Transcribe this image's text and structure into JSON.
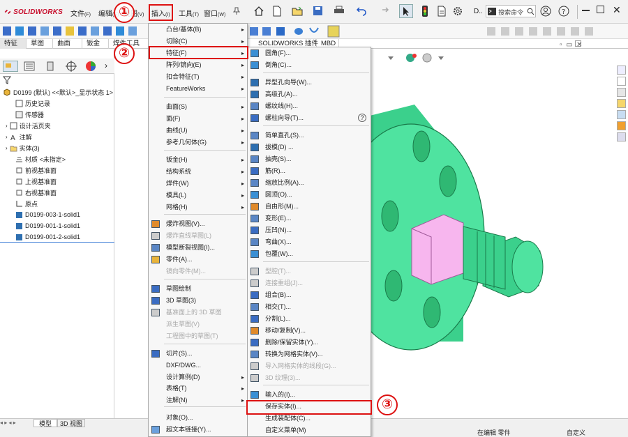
{
  "app": {
    "logo": "SOLIDWORKS"
  },
  "menubar": {
    "file": "文件",
    "file_k": "(F)",
    "edit": "编辑",
    "edit_k": "(E)",
    "view": "视图",
    "view_k": "(V)",
    "insert": "插入",
    "insert_k": "(I)",
    "tools": "工具",
    "tools_k": "(T)",
    "window": "窗口",
    "window_k": "(W)",
    "d_label": "D..",
    "search_placeholder": "搜索命令"
  },
  "tabs": [
    "特征",
    "草图",
    "曲面",
    "钣金",
    "焊件工具",
    "SOLIDWORKS 插件",
    "MBD"
  ],
  "tree": {
    "root": "D0199 (默认) <<默认>_显示状态 1>",
    "items": [
      "历史记录",
      "传感器",
      "设计活页夹",
      "注解",
      "实体(3)",
      "材质 <未指定>",
      "前视基准面",
      "上视基准面",
      "右视基准面",
      "原点",
      "D0199-003-1-solid1",
      "D0199-001-1-solid1",
      "D0199-001-2-solid1"
    ]
  },
  "insert_menu": [
    {
      "label": "凸台/基体(B)",
      "sub": true,
      "disabled": false
    },
    {
      "label": "切除(C)",
      "sub": true,
      "disabled": false
    },
    {
      "label": "特征(F)",
      "sub": true,
      "disabled": false
    },
    {
      "label": "阵列/镜向(E)",
      "sub": true,
      "disabled": false
    },
    {
      "label": "扣合特征(T)",
      "sub": true,
      "disabled": false
    },
    {
      "label": "FeatureWorks",
      "sub": true,
      "disabled": false
    },
    {
      "label": "曲面(S)",
      "sub": true,
      "disabled": false
    },
    {
      "label": "面(F)",
      "sub": true,
      "disabled": false
    },
    {
      "label": "曲线(U)",
      "sub": true,
      "disabled": false
    },
    {
      "label": "参考几何体(G)",
      "sub": true,
      "disabled": false
    },
    {
      "label": "钣金(H)",
      "sub": true,
      "disabled": false
    },
    {
      "label": "结构系统",
      "sub": true,
      "disabled": false
    },
    {
      "label": "焊件(W)",
      "sub": true,
      "disabled": false
    },
    {
      "label": "模具(L)",
      "sub": true,
      "disabled": false
    },
    {
      "label": "网格(H)",
      "sub": true,
      "disabled": false
    },
    {
      "label": "爆炸视图(V)...",
      "sub": false,
      "disabled": false
    },
    {
      "label": "爆炸直线草图(L)",
      "sub": false,
      "disabled": true
    },
    {
      "label": "模型断裂视图(I)...",
      "sub": false,
      "disabled": false
    },
    {
      "label": "零件(A)...",
      "sub": false,
      "disabled": false
    },
    {
      "label": "镜向零件(M)...",
      "sub": false,
      "disabled": true
    },
    {
      "label": "草图绘制",
      "sub": false,
      "disabled": false
    },
    {
      "label": "3D 草图(3)",
      "sub": false,
      "disabled": false
    },
    {
      "label": "基准面上的 3D 草图",
      "sub": false,
      "disabled": true
    },
    {
      "label": "派生草图(V)",
      "sub": false,
      "disabled": true
    },
    {
      "label": "工程图中的草图(T)",
      "sub": false,
      "disabled": true
    },
    {
      "label": "切片(S)...",
      "sub": false,
      "disabled": false
    },
    {
      "label": "DXF/DWG...",
      "sub": false,
      "disabled": false
    },
    {
      "label": "设计算例(D)",
      "sub": true,
      "disabled": false
    },
    {
      "label": "表格(T)",
      "sub": true,
      "disabled": false
    },
    {
      "label": "注解(N)",
      "sub": true,
      "disabled": false
    },
    {
      "label": "对象(O)...",
      "sub": false,
      "disabled": false
    },
    {
      "label": "超文本链接(Y)...",
      "sub": false,
      "disabled": false
    }
  ],
  "feature_menu": [
    {
      "label": "圆角(F)...",
      "disabled": false
    },
    {
      "label": "倒角(C)...",
      "disabled": false
    },
    {
      "label": "异型孔向导(W)...",
      "disabled": false
    },
    {
      "label": "高级孔(A)...",
      "disabled": false
    },
    {
      "label": "螺纹线(H)...",
      "disabled": false
    },
    {
      "label": "螺柱向导(T)...",
      "disabled": false
    },
    {
      "label": "简单直孔(S)...",
      "disabled": false
    },
    {
      "label": "拔模(D) ...",
      "disabled": false
    },
    {
      "label": "抽壳(S)...",
      "disabled": false
    },
    {
      "label": "筋(R)...",
      "disabled": false
    },
    {
      "label": "缩放比例(A)...",
      "disabled": false
    },
    {
      "label": "圆顶(O)...",
      "disabled": false
    },
    {
      "label": "自由形(M)...",
      "disabled": false
    },
    {
      "label": "变形(E)...",
      "disabled": false
    },
    {
      "label": "压凹(N)...",
      "disabled": false
    },
    {
      "label": "弯曲(X)...",
      "disabled": false
    },
    {
      "label": "包覆(W)...",
      "disabled": false
    },
    {
      "label": "型腔(T)...",
      "disabled": true
    },
    {
      "label": "连接重组(J)...",
      "disabled": true
    },
    {
      "label": "组合(B)...",
      "disabled": false
    },
    {
      "label": "相交(T)...",
      "disabled": false
    },
    {
      "label": "分割(L)...",
      "disabled": false
    },
    {
      "label": "移动/复制(V)...",
      "disabled": false
    },
    {
      "label": "删除/保留实体(Y)...",
      "disabled": false
    },
    {
      "label": "转换为网格实体(V)...",
      "disabled": false
    },
    {
      "label": "导入网格实体的线段(G)...",
      "disabled": true
    },
    {
      "label": "3D 纹理(3)...",
      "disabled": true
    },
    {
      "label": "输入的(I)...",
      "disabled": false
    },
    {
      "label": "保存实体(I)...",
      "disabled": false
    },
    {
      "label": "生成装配体(C)...",
      "disabled": false
    },
    {
      "label": "自定义菜单(M)",
      "disabled": false
    }
  ],
  "status": {
    "tab_model": "模型",
    "tab_3d": "3D 视图",
    "editing": "在编辑 零件",
    "custom": "自定义"
  },
  "annotations": {
    "b1": "①",
    "b2": "②",
    "b3": "③"
  },
  "colors": {
    "accent_red": "#dd1111",
    "model_green": "#4fe3a0",
    "model_pink": "#f7b6ee"
  }
}
